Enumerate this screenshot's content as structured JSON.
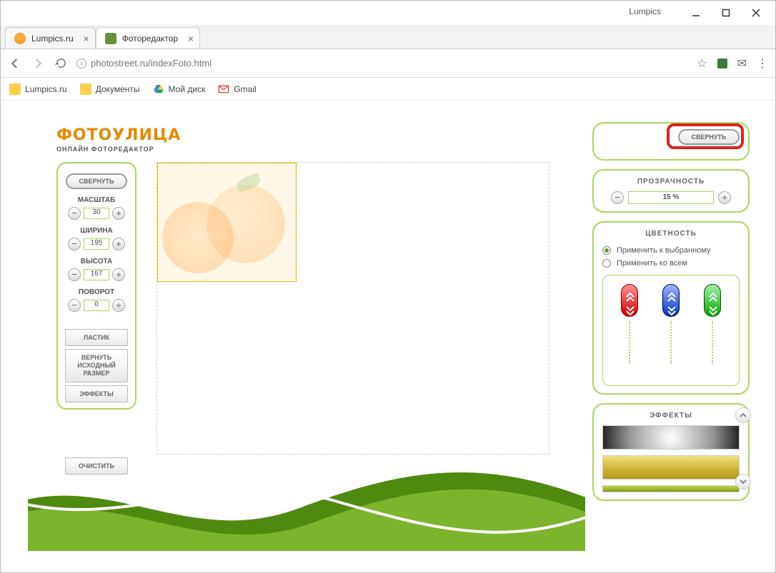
{
  "window": {
    "title": "Lumpics"
  },
  "tabs": [
    {
      "label": "Lumpics.ru",
      "active": false
    },
    {
      "label": "Фоторедактор",
      "active": true
    }
  ],
  "url": "photostreet.ru/indexFoto.html",
  "bookmarks": {
    "b1": "Lumpics.ru",
    "b2": "Документы",
    "b3": "Мой диск",
    "b4": "Gmail"
  },
  "logo": {
    "main": "ФОТОУЛИЦА",
    "sub": "ОНЛАЙН ФОТОРЕДАКТОР"
  },
  "left": {
    "collapse": "СВЕРНУТЬ",
    "scale_label": "МАСШТАБ",
    "scale_value": "30",
    "width_label": "ШИРИНА",
    "width_value": "195",
    "height_label": "ВЫСОТА",
    "height_value": "167",
    "rotate_label": "ПОВОРОТ",
    "rotate_value": "0",
    "eraser": "ЛАСТИК",
    "restore": "ВЕРНУТЬ ИСХОДНЫЙ РАЗМЕР",
    "effects": "ЭФФЕКТЫ",
    "clear": "ОЧИСТИТЬ"
  },
  "right": {
    "collapse": "СВЕРНУТЬ",
    "transparency_label": "ПРОЗРАЧНОСТЬ",
    "transparency_value": "15 %",
    "color_label": "ЦВЕТНОСТЬ",
    "apply_selected": "Применить к выбранному",
    "apply_all": "Применить ко всем",
    "effects_label": "ЭФФЕКТЫ"
  }
}
